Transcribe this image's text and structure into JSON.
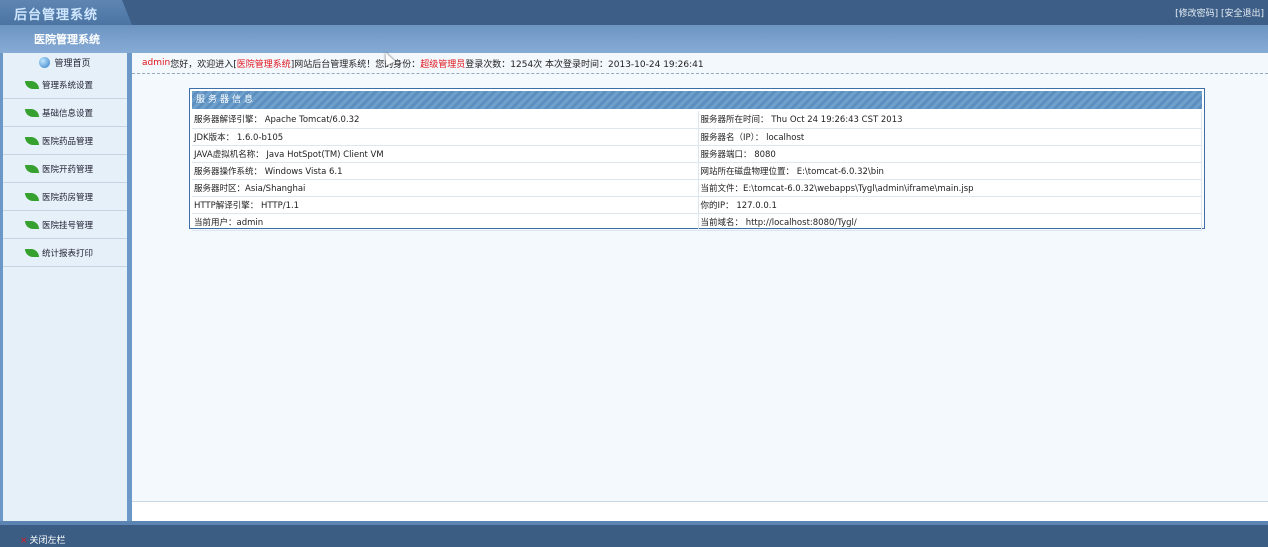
{
  "header": {
    "logo": "后台管理系统",
    "change_password": "[修改密码]",
    "logout": "[安全退出]",
    "subtitle": "医院管理系统"
  },
  "sidebar": {
    "home": "管理首页",
    "items": [
      {
        "label": "管理系统设置"
      },
      {
        "label": "基础信息设置"
      },
      {
        "label": "医院药品管理"
      },
      {
        "label": "医院开药管理"
      },
      {
        "label": "医院药房管理"
      },
      {
        "label": "医院挂号管理"
      },
      {
        "label": "统计报表打印"
      }
    ]
  },
  "welcome": {
    "user": "admin",
    "greeting": " 您好，欢迎进入[",
    "system_name": "医院管理系统",
    "mid": "]网站后台管理系统！您的身份：",
    "role": "超级管理员",
    "login_info": " 登录次数：1254次 本次登录时间：2013-10-24 19:26:41"
  },
  "server_info": {
    "title": "服务器信息",
    "rows": [
      [
        "服务器解译引擎： Apache Tomcat/6.0.32",
        "服务器所在时间： Thu Oct 24 19:26:43 CST 2013"
      ],
      [
        "JDK版本： 1.6.0-b105",
        "服务器名（IP）： localhost"
      ],
      [
        "JAVA虚拟机名称： Java HotSpot(TM) Client VM",
        "服务器端口： 8080"
      ],
      [
        "服务器操作系统： Windows Vista 6.1",
        "网站所在磁盘物理位置： E:\\tomcat-6.0.32\\bin"
      ],
      [
        "服务器时区：Asia/Shanghai",
        "当前文件：E:\\tomcat-6.0.32\\webapps\\Tygl\\admin\\iframe\\main.jsp"
      ],
      [
        "HTTP解译引擎： HTTP/1.1",
        "你的IP： 127.0.0.1"
      ],
      [
        "当前用户：admin",
        "当前域名： http://localhost:8080/Tygl/"
      ]
    ]
  },
  "footer": {
    "close_sidebar": "关闭左栏"
  }
}
